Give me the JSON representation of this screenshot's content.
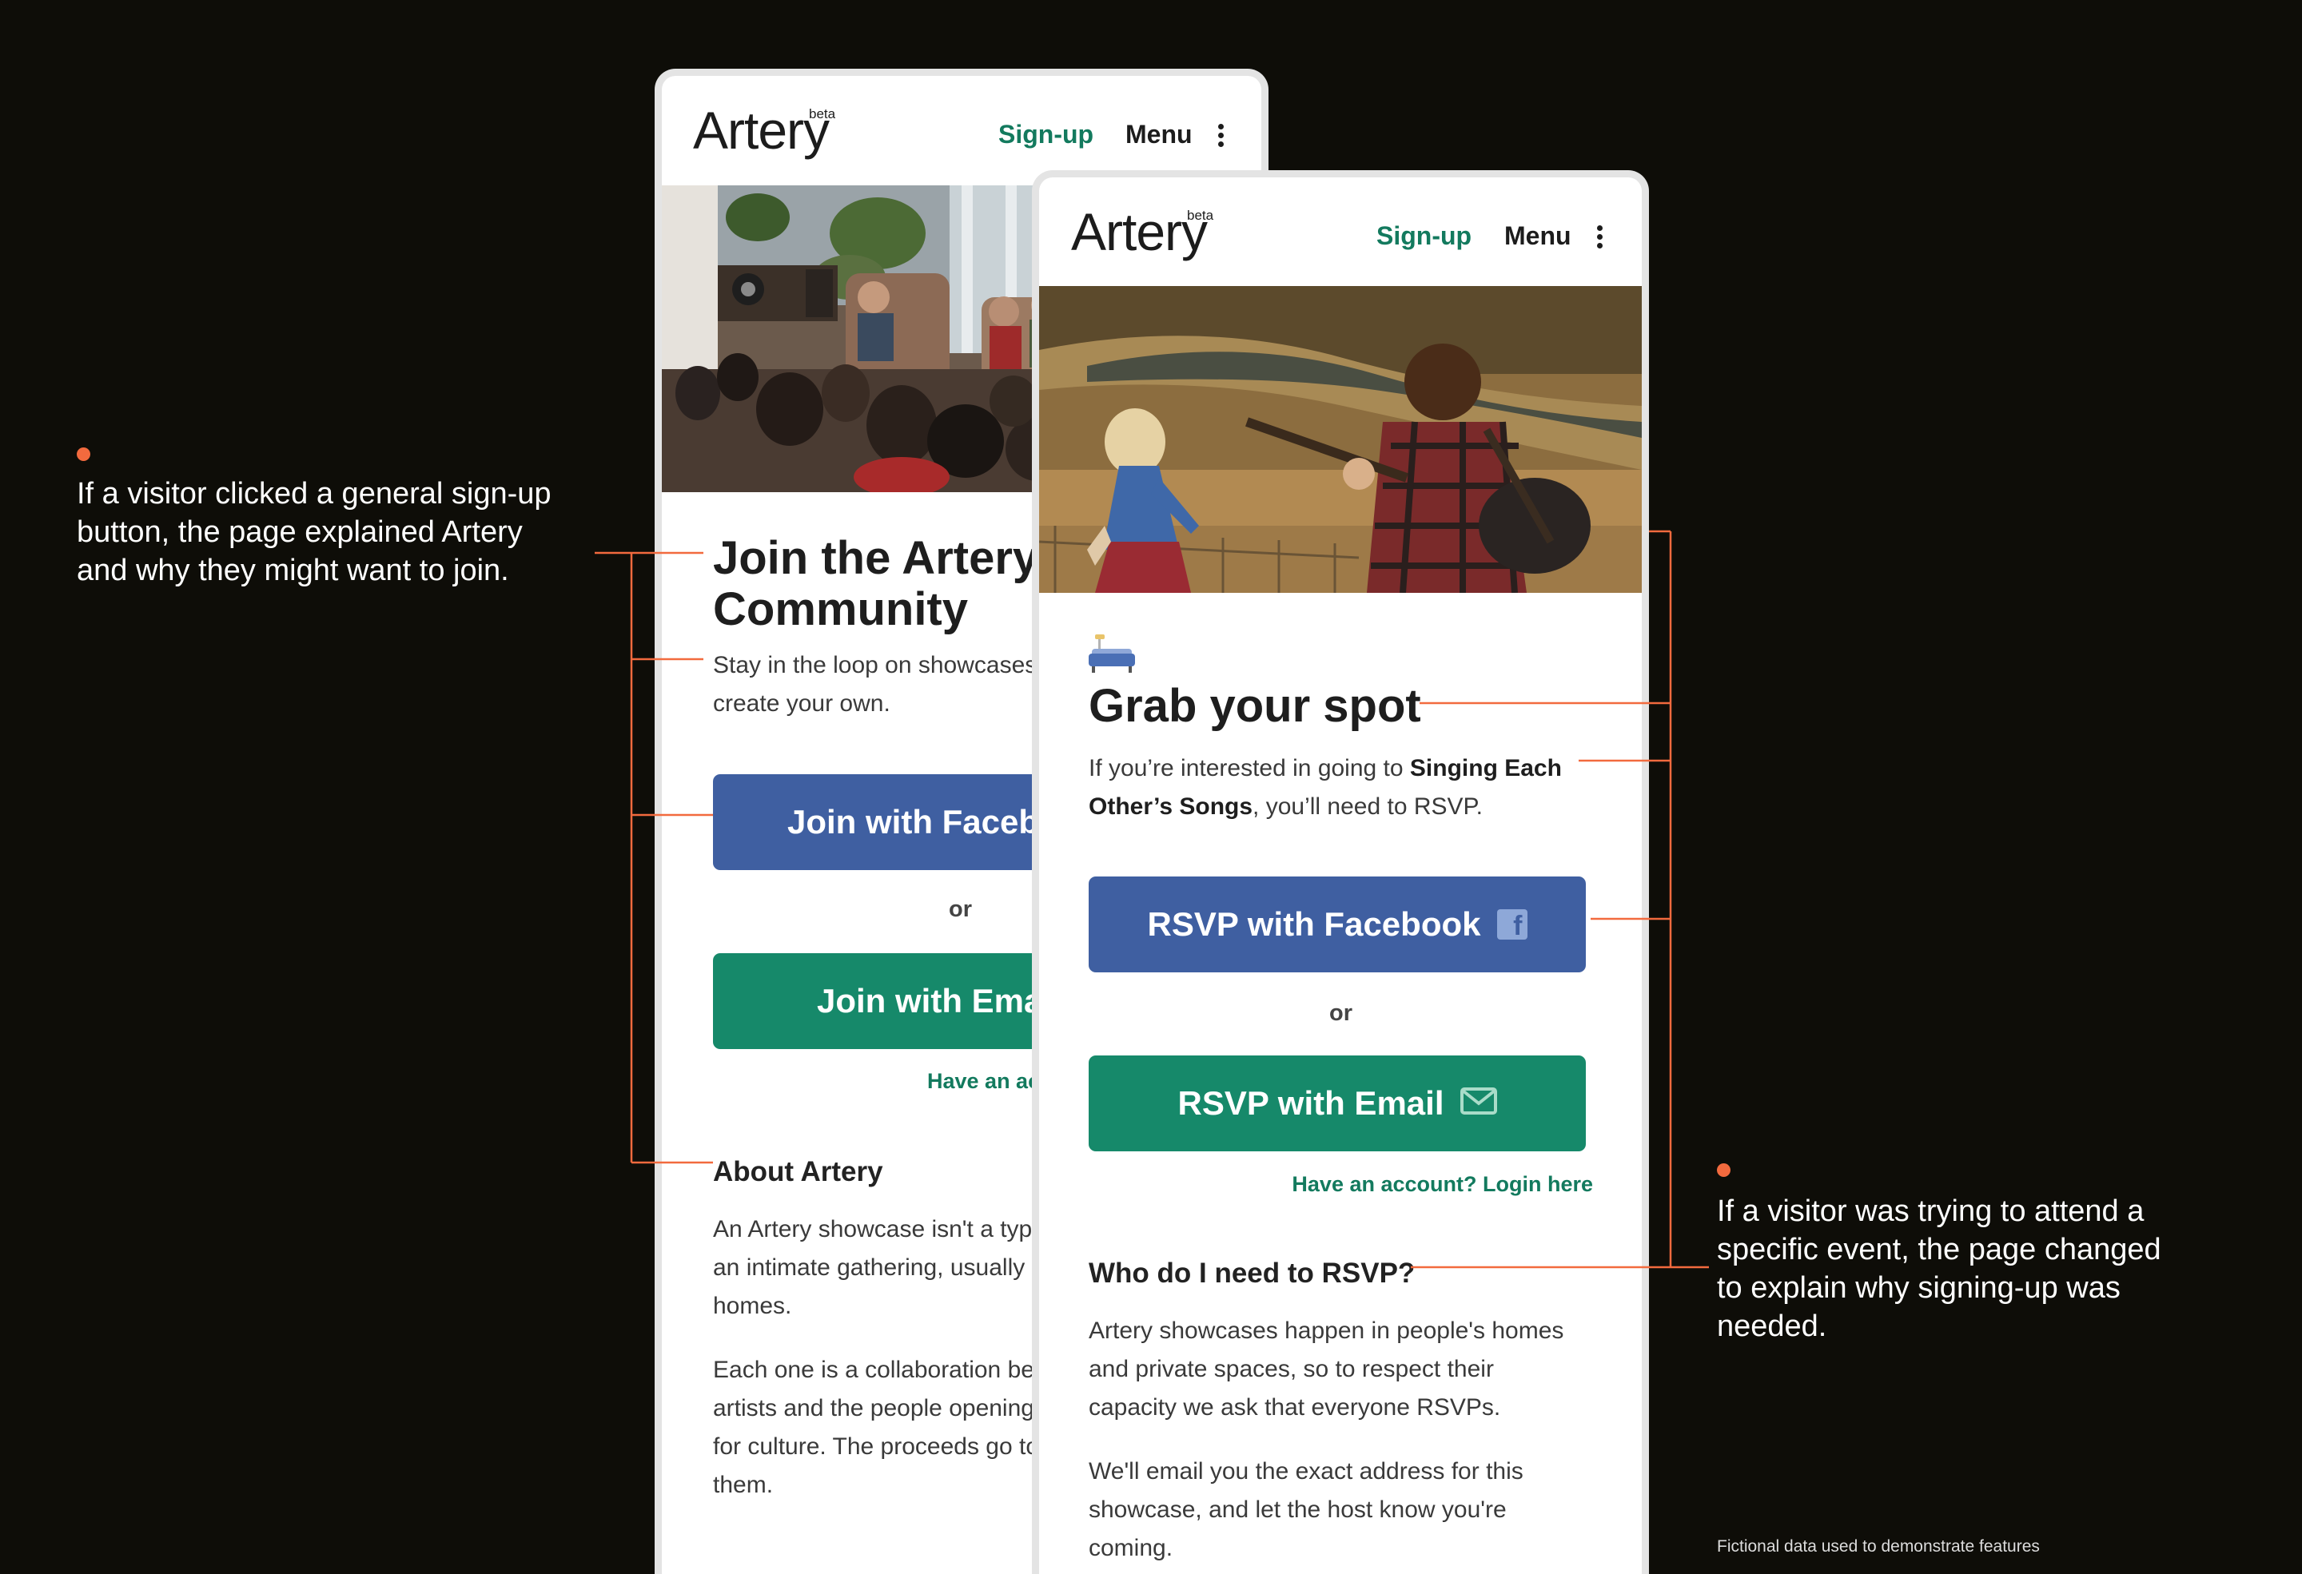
{
  "annotations": {
    "left_lines": [
      "If a visitor clicked a general sign-up",
      "button, the page explained Artery",
      "and why they might want to join."
    ],
    "right_lines": [
      "If a visitor was trying to attend a",
      "specific event, the page changed",
      "to explain why signing-up was",
      "needed."
    ],
    "accent_color": "#f26a3e"
  },
  "footnote": "Fictional data used to demonstrate features",
  "left_screen": {
    "logo": "Artery",
    "beta": "beta",
    "nav": {
      "signup": "Sign-up",
      "menu": "Menu"
    },
    "title_lines": [
      "Join the Artery",
      "Community"
    ],
    "intro_lines": [
      "Stay in the loop on showcases",
      "create your own."
    ],
    "facebook_button": "Join with Facebook",
    "or": "or",
    "email_button": "Join with Email",
    "account_link": "Have an account? Login here",
    "about_heading": "About Artery",
    "about_p1_lines": [
      "An Artery showcase isn't a typical",
      "an intimate gathering, usually",
      "homes."
    ],
    "about_p2_lines": [
      "Each one is a collaboration between",
      "artists and the people opening",
      "for culture. The proceeds go to",
      "them."
    ]
  },
  "right_screen": {
    "logo": "Artery",
    "beta": "beta",
    "nav": {
      "signup": "Sign-up",
      "menu": "Menu"
    },
    "title": "Grab your spot",
    "intro_line1_prefix": "If you’re interested in going to ",
    "intro_line1_bold": "Singing Each",
    "intro_line2_bold": "Other’s Songs",
    "intro_line2_suffix": ", you’ll need to RSVP.",
    "facebook_button": "RSVP with Facebook",
    "or": "or",
    "email_button": "RSVP with Email",
    "account_link": "Have an account? Login here",
    "faq_heading": "Who do I need to RSVP?",
    "faq_p1_lines": [
      "Artery showcases happen in people's homes",
      "and private spaces, so to respect their",
      "capacity we ask that everyone RSVPs."
    ],
    "faq_p2_lines": [
      "We'll email you the exact address for this",
      "showcase, and let the host know you're",
      "coming."
    ]
  },
  "colors": {
    "background": "#0e0d08",
    "brand_green": "#137a5e",
    "email_button": "#16896a",
    "facebook_button": "#3f5fa1"
  },
  "icons": [
    "kebab-menu-icon",
    "facebook-icon",
    "envelope-icon",
    "couch-icon"
  ]
}
